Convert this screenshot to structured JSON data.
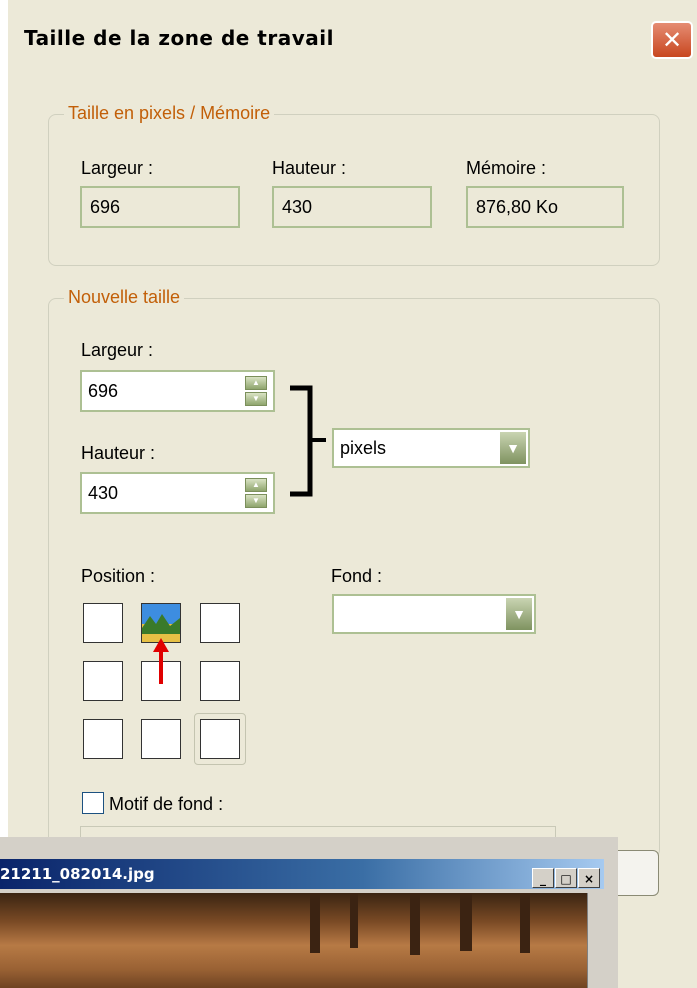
{
  "dialog": {
    "title": "Taille de la zone de travail",
    "close_symbol": "✕"
  },
  "current_size": {
    "legend": "Taille en pixels / Mémoire",
    "width_label": "Largeur :",
    "width_value": "696",
    "height_label": "Hauteur :",
    "height_value": "430",
    "memory_label": "Mémoire :",
    "memory_value": "876,80 Ko"
  },
  "new_size": {
    "legend": "Nouvelle taille",
    "width_label": "Largeur :",
    "width_value": "696",
    "height_label": "Hauteur :",
    "height_value": "430",
    "unit_selected": "pixels",
    "position_label": "Position :",
    "background_label": "Fond :",
    "background_selected": "",
    "pattern_label": "Motif de fond :",
    "pattern_checked": false
  },
  "overlap_window": {
    "title": "21211_082014.jpg",
    "btn_minimize": "_",
    "btn_maximize": "□",
    "btn_close": "×"
  },
  "colors": {
    "dialog_bg": "#ece9d8",
    "legend_text": "#c25f08",
    "field_border": "#adc093",
    "close_button": "#c8471f",
    "arrow_red": "#e00000"
  },
  "icons": [
    "close-icon",
    "spin-up-icon",
    "spin-down-icon",
    "dropdown-arrow-icon",
    "landscape-thumbnail-icon",
    "red-arrow-indicator-icon"
  ]
}
